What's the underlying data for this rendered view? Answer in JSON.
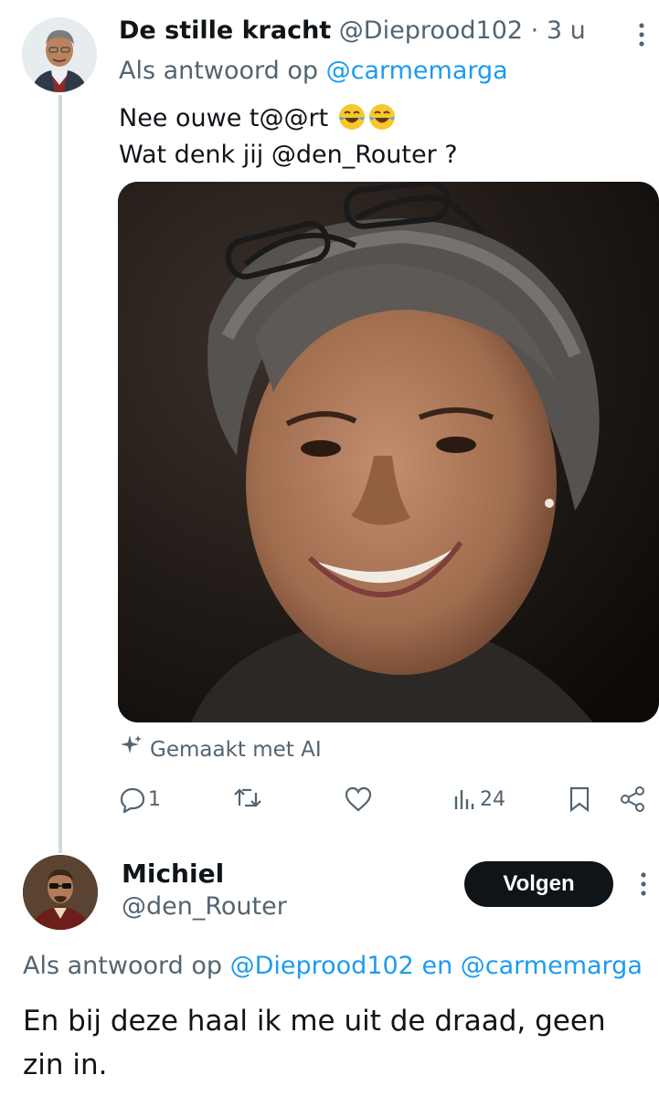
{
  "tweet1": {
    "author_name": "De stille kracht",
    "handle": "@Dieprood102",
    "separator": "·",
    "time": "3 u",
    "reply_prefix": "Als antwoord op",
    "reply_to": "@carmemarga",
    "line1": "Nee ouwe t@@rt",
    "line2": "Wat denk jij @den_Router ?",
    "emoji": "laughing-tears-emoji",
    "ai_label": "Gemaakt met AI",
    "stats": {
      "replies": "1",
      "views": "24"
    }
  },
  "tweet2": {
    "author_name": "Michiel",
    "handle": "@den_Router",
    "follow_label": "Volgen",
    "reply_prefix": "Als antwoord op",
    "reply_to_1": "@Dieprood102",
    "reply_join": "en",
    "reply_to_2": "@carmemarga",
    "text": "En bij deze haal ik me uit de draad, geen zin in."
  },
  "colors": {
    "accent": "#1d9bf0",
    "text": "#0f1419",
    "muted": "#536471",
    "thread_line": "#cfd9de",
    "button": "#0f1419"
  }
}
